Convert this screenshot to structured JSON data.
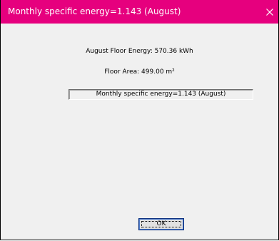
{
  "window": {
    "title": "Monthly specific energy=1.143 (August)",
    "close_glyph": "×",
    "title_bar_color": "#e6007e"
  },
  "content": {
    "energy_line": "August Floor Energy: 570.36 kWh",
    "area_line": "Floor Area: 499.00 m²",
    "result_text": "Monthly specific energy=1.143 (August)"
  },
  "buttons": {
    "ok_label": "OK"
  },
  "icons": {
    "close": "close-icon"
  }
}
